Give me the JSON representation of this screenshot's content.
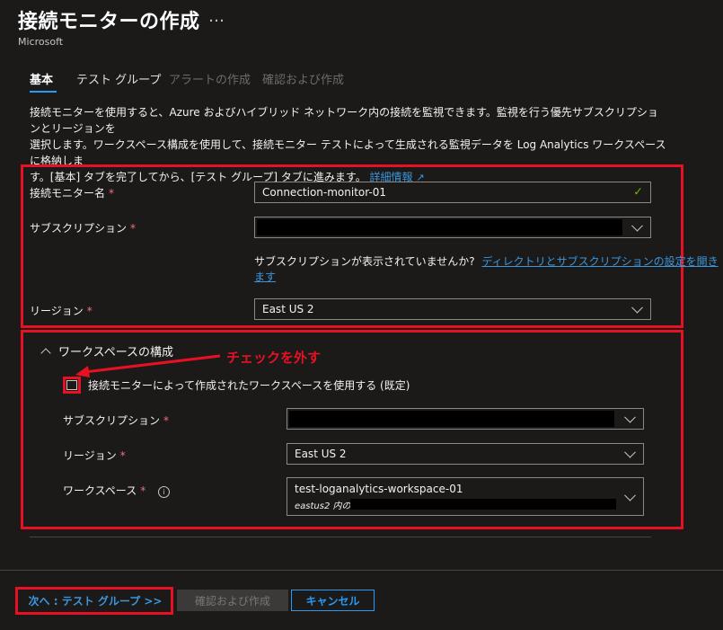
{
  "header": {
    "title": "接続モニターの作成",
    "more_label": "…",
    "publisher": "Microsoft"
  },
  "tabs": [
    {
      "label": "基本",
      "state": "active"
    },
    {
      "label": "テスト グループ",
      "state": "enabled"
    },
    {
      "label": "アラートの作成",
      "state": "disabled"
    },
    {
      "label": "確認および作成",
      "state": "disabled"
    }
  ],
  "description": {
    "line1": "接続モニターを使用すると、Azure およびハイブリッド ネットワーク内の接続を監視できます。監視を行う優先サブスクリプションとリージョンを",
    "line2": "選択します。ワークスペース構成を使用して、接続モニター テストによって生成される監視データを Log Analytics ワークスペースに格納しま",
    "line3": "す。[基本] タブを完了してから、[テスト グループ] タブに進みます。",
    "link": "詳細情報"
  },
  "form": {
    "name_label": "接続モニター名",
    "name_value": "Connection-monitor-01",
    "subscription_label": "サブスクリプション",
    "subscription_hint": "サブスクリプションが表示されていませんか?",
    "subscription_link": "ディレクトリとサブスクリプションの設定を開きます",
    "region_label": "リージョン",
    "region_value": "East US 2",
    "required_mark": "*"
  },
  "workspace": {
    "section_title": "ワークスペースの構成",
    "checkbox_label": "接続モニターによって作成されたワークスペースを使用する (既定)",
    "checkbox_checked": false,
    "subscription_label": "サブスクリプション",
    "region_label": "リージョン",
    "region_value": "East US 2",
    "workspace_label": "ワークスペース",
    "workspace_value": "test-loganalytics-workspace-01",
    "workspace_sub": "eastus2 内の"
  },
  "annotation": {
    "text": "チェックを外す",
    "color": "#e81123"
  },
  "footer": {
    "next_label": "次へ : テスト グループ >>",
    "review_label": "確認および作成",
    "cancel_label": "キャンセル"
  },
  "colors": {
    "background": "#1b1a19",
    "accent": "#2899f5",
    "link": "#3a96dd",
    "required": "#f1707b",
    "success": "#6bb700",
    "annotation": "#e81123"
  }
}
